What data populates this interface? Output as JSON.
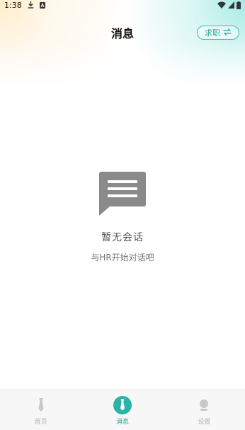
{
  "status_bar": {
    "time": "1:38",
    "icons": [
      "download-icon",
      "notification-a-icon"
    ],
    "right_icons": [
      "wifi-icon",
      "signal-icon",
      "battery-icon"
    ]
  },
  "header": {
    "title": "消息",
    "mode_switch_label": "求职",
    "mode_switch_icon": "swap-icon"
  },
  "empty_state": {
    "icon": "message-bubble-icon",
    "title": "暂无会话",
    "subtitle": "与HR开始对话吧"
  },
  "bottom_nav": {
    "items": [
      {
        "label": "首页",
        "icon": "tie-icon",
        "active": false
      },
      {
        "label": "消息",
        "icon": "tie-icon",
        "active": true
      },
      {
        "label": "设置",
        "icon": "profile-icon",
        "active": false
      }
    ]
  },
  "colors": {
    "accent": "#2ab3a6",
    "inactive": "#b5b5b5",
    "empty_icon": "#8a8a8a"
  }
}
